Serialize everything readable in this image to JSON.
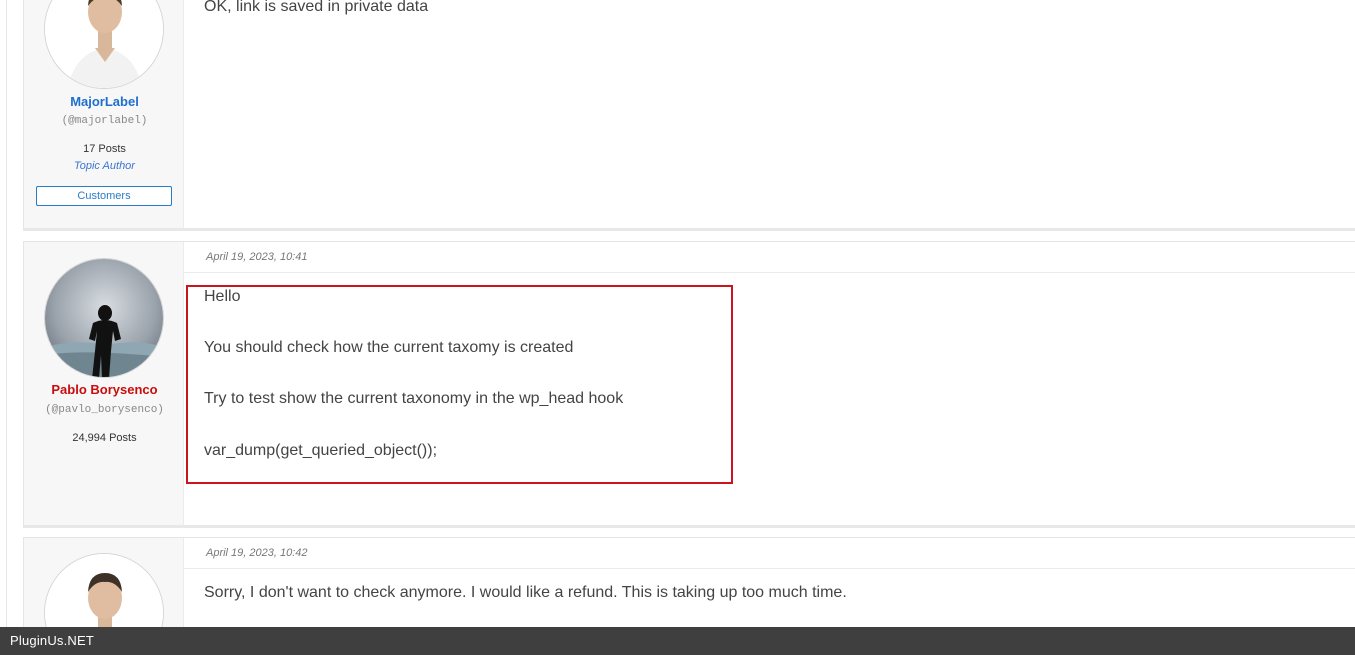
{
  "replies": [
    {
      "author": {
        "name": "MajorLabel",
        "handle": "(@majorlabel)",
        "posts": "17 Posts",
        "role": "Topic Author",
        "badge": "Customers"
      },
      "lines": [
        "OK, link is saved in private data"
      ]
    },
    {
      "date": "April 19, 2023, 10:41",
      "author": {
        "name": "Pablo Borysenco",
        "handle": "(@pavlo_borysenco)",
        "posts": "24,994 Posts"
      },
      "lines": [
        "Hello",
        "You should check how the current taxomy is created",
        "Try to test show the current taxonomy in the wp_head hook",
        "var_dump(get_queried_object());"
      ]
    },
    {
      "date": "April 19, 2023, 10:42",
      "lines": [
        "Sorry, I don't want to check anymore. I would like a refund. This is taking up too much time."
      ]
    }
  ],
  "footer": {
    "brand": "PluginUs.NET"
  },
  "colors": {
    "highlight": "#c9151b",
    "author_blue": "#1e6fcf",
    "author_red": "#c90d0d",
    "footer_bg": "#3f3f3f"
  }
}
